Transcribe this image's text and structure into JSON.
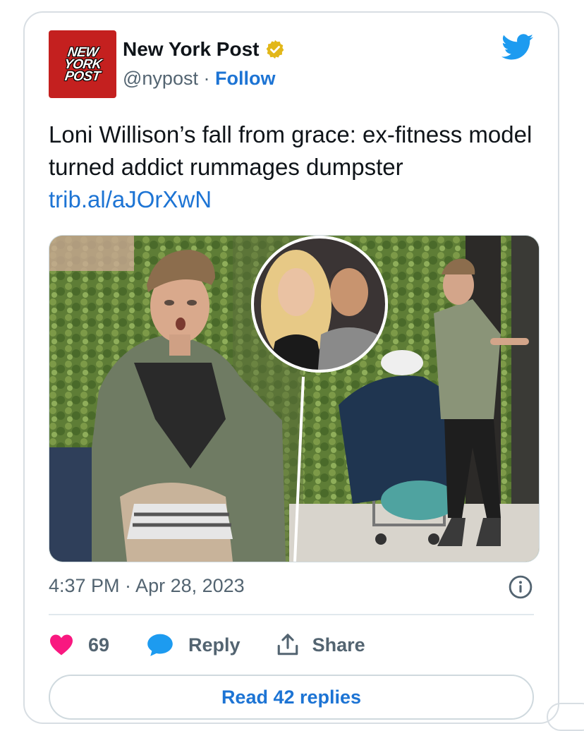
{
  "account": {
    "logo_lines": [
      "NEW",
      "YORK",
      "POST"
    ],
    "name": "New York Post",
    "handle": "@nypost",
    "separator": " · ",
    "follow_label": "Follow"
  },
  "tweet": {
    "text": "Loni Willison’s fall from grace: ex-fitness model turned addict rummages dumpster ",
    "link": "trib.al/aJOrXwN",
    "timestamp": "4:37 PM · Apr 28, 2023"
  },
  "actions": {
    "like_count": "69",
    "reply_label": "Reply",
    "share_label": "Share"
  },
  "read_replies_label": "Read 42 replies",
  "icons": {
    "verified": "verified-badge-icon",
    "bird": "twitter-bird-icon",
    "info": "info-icon",
    "like": "heart-icon",
    "reply": "reply-bubble-icon",
    "share": "share-icon"
  },
  "colors": {
    "brand_red": "#c4201f",
    "link_blue": "#1d74d4",
    "twitter_blue": "#1d9bf0",
    "heart": "#f91880",
    "verified_gold": "#e2b719",
    "muted_text": "#536471"
  }
}
